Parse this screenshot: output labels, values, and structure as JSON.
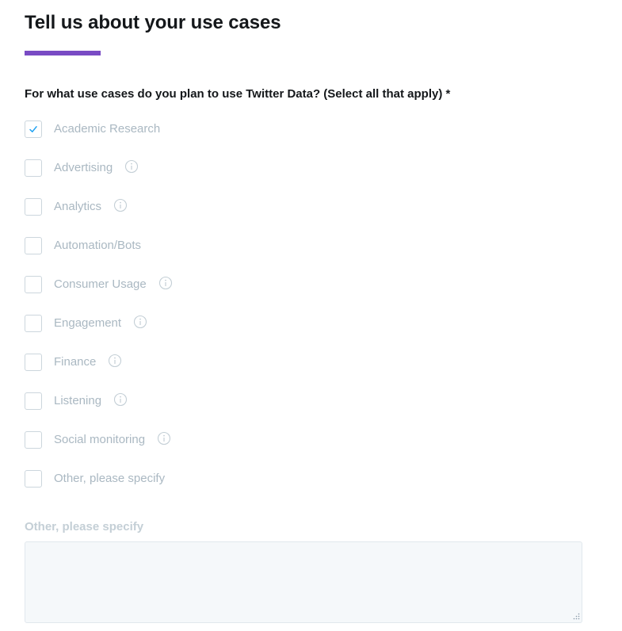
{
  "page": {
    "title": "Tell us about your use cases",
    "accent_color": "#794bc4"
  },
  "question": {
    "label": "For what use cases do you plan to use Twitter Data? (Select all that apply) *"
  },
  "options": [
    {
      "label": "Academic Research",
      "checked": true,
      "has_info": false
    },
    {
      "label": "Advertising",
      "checked": false,
      "has_info": true
    },
    {
      "label": "Analytics",
      "checked": false,
      "has_info": true
    },
    {
      "label": "Automation/Bots",
      "checked": false,
      "has_info": false
    },
    {
      "label": "Consumer Usage",
      "checked": false,
      "has_info": true
    },
    {
      "label": "Engagement",
      "checked": false,
      "has_info": true
    },
    {
      "label": "Finance",
      "checked": false,
      "has_info": true
    },
    {
      "label": "Listening",
      "checked": false,
      "has_info": true
    },
    {
      "label": "Social monitoring",
      "checked": false,
      "has_info": true
    },
    {
      "label": "Other, please specify",
      "checked": false,
      "has_info": false
    }
  ],
  "other_field": {
    "label": "Other, please specify",
    "value": ""
  },
  "icons": {
    "check": "check-icon",
    "info": "info-icon",
    "resize": "resize-grip-icon"
  },
  "colors": {
    "check": "#1da1f2",
    "muted_text": "#aab8c2",
    "heading_text": "#14171a"
  }
}
